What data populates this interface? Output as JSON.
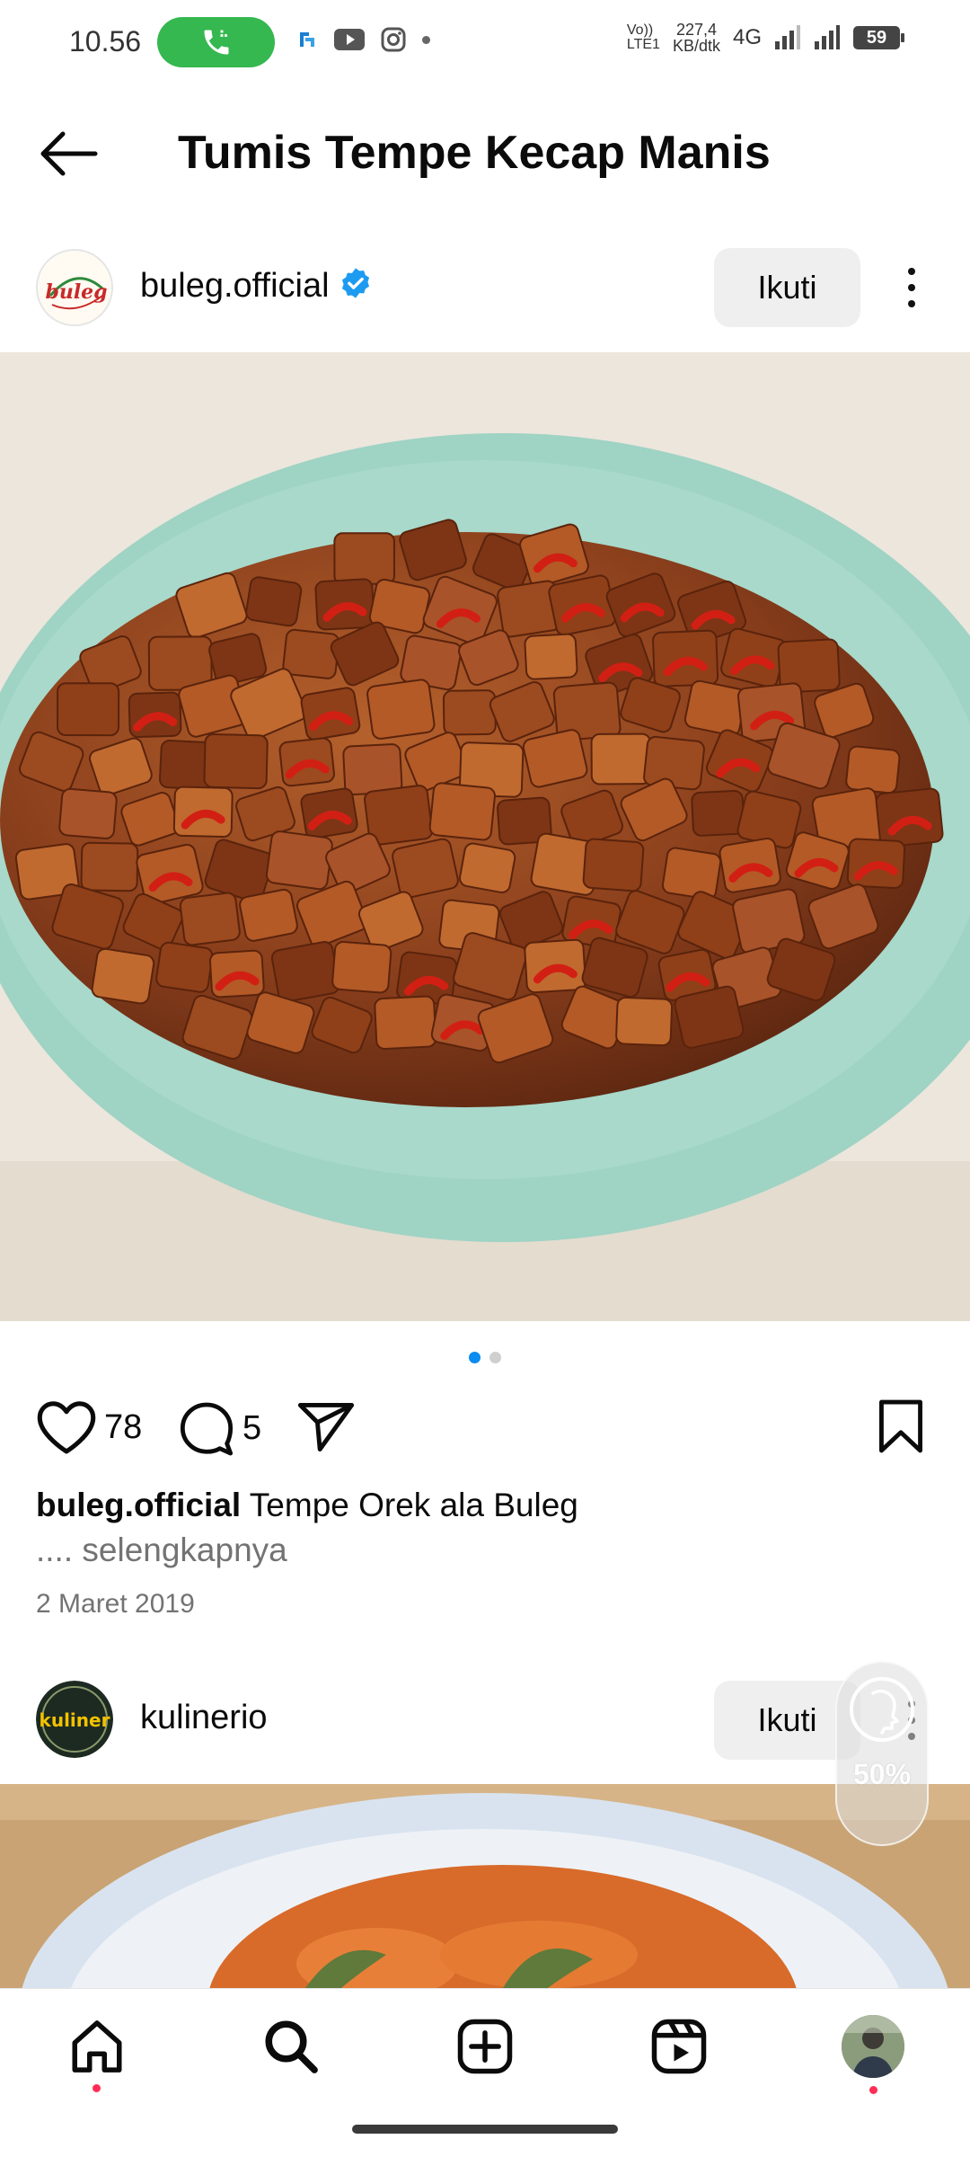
{
  "status_bar": {
    "time": "10.56",
    "net_speed_top": "227,4",
    "net_speed_bottom": "KB/dtk",
    "volte_top": "Vo))",
    "volte_bottom": "LTE1",
    "network": "4G",
    "battery": "59"
  },
  "header": {
    "title": "Tumis Tempe Kecap Manis"
  },
  "post1": {
    "username": "buleg.official",
    "avatar_text": "buleg",
    "follow_label": "Ikuti",
    "likes": "78",
    "comments": "5",
    "caption_user": "buleg.official",
    "caption_text": " Tempe Orek ala Buleg",
    "caption_more": ".... selengkapnya",
    "date": "2 Maret 2019",
    "carousel_total": 2,
    "carousel_index": 1
  },
  "post2": {
    "username": "kulinerio",
    "avatar_text": "kuliner",
    "follow_label": "Ikuti"
  },
  "zoom_widget": {
    "percent": "50%"
  },
  "colors": {
    "accent": "#0a8cf0",
    "call_green": "#35b84f",
    "verified_blue": "#1d9bf0",
    "notification_red": "#ff2d55"
  },
  "icons": {
    "back": "arrow-left-icon",
    "verified": "verified-badge-icon",
    "more": "more-vertical-icon",
    "like": "heart-icon",
    "comment": "comment-icon",
    "share": "send-icon",
    "save": "bookmark-icon",
    "home": "home-icon",
    "search": "search-icon",
    "create": "plus-square-icon",
    "reels": "reels-icon",
    "profile": "profile-avatar"
  }
}
